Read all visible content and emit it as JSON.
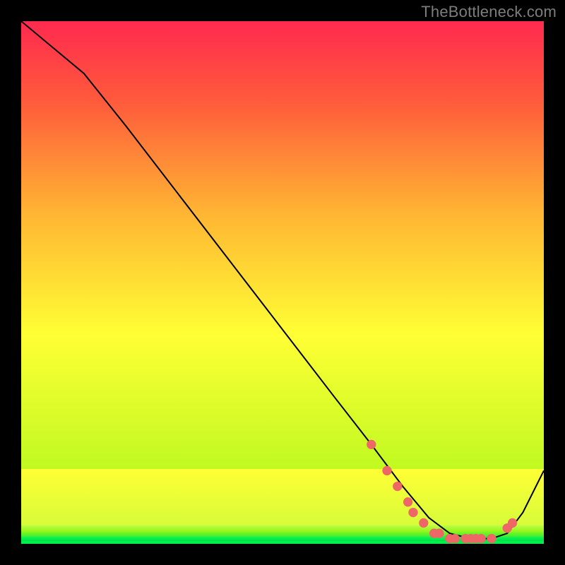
{
  "attribution": "TheBottleneck.com",
  "chart_data": {
    "type": "line",
    "title": "",
    "xlabel": "",
    "ylabel": "",
    "xlim": [
      0,
      100
    ],
    "ylim": [
      0,
      100
    ],
    "grid": false,
    "background_gradient": {
      "stops": [
        {
          "pos": 0.0,
          "color": "#0bf04e"
        },
        {
          "pos": 0.02,
          "color": "#5cf12c"
        },
        {
          "pos": 0.04,
          "color": "#a7f71a"
        },
        {
          "pos": 0.4,
          "color": "#ffff34"
        },
        {
          "pos": 0.63,
          "color": "#ffb633"
        },
        {
          "pos": 0.85,
          "color": "#ff593c"
        },
        {
          "pos": 1.0,
          "color": "#ff2a4f"
        }
      ]
    },
    "series": [
      {
        "name": "bottleneck-curve",
        "color": "#000000",
        "x": [
          0,
          6,
          12,
          20,
          30,
          40,
          50,
          60,
          67,
          73,
          78,
          82,
          86,
          90,
          93,
          96,
          100
        ],
        "y": [
          100,
          95,
          90,
          80,
          67,
          54,
          41,
          28,
          19,
          11,
          5,
          2,
          1,
          1,
          2,
          6,
          14
        ]
      }
    ],
    "valley_markers": {
      "name": "optimal-range-dots",
      "color": "#ee6666",
      "x": [
        67,
        70,
        72,
        74,
        75,
        77,
        79,
        80,
        82,
        83,
        85,
        86,
        87,
        88,
        90,
        93,
        94
      ],
      "y": [
        19,
        14,
        11,
        8,
        6,
        4,
        2,
        2,
        1,
        1,
        1,
        1,
        1,
        1,
        1,
        3,
        4
      ]
    }
  }
}
